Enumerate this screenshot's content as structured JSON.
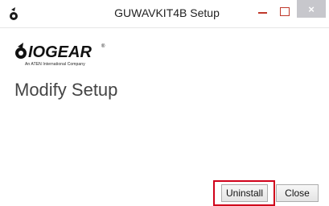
{
  "window": {
    "title": "GUWAVKIT4B Setup",
    "icon": "iogear-app-icon",
    "controls": {
      "minimize_icon": "minimize-icon",
      "maximize_icon": "maximize-icon",
      "close_glyph": "×"
    }
  },
  "branding": {
    "logo_text": "IOGEAR",
    "logo_trademark": "®",
    "tagline": "An ATEN International Company"
  },
  "main": {
    "heading": "Modify Setup"
  },
  "buttons": {
    "uninstall_label": "Uninstall",
    "close_label": "Close"
  },
  "colors": {
    "highlight": "#d0021b",
    "window_controls": "#c0392b",
    "close_button_bg": "#c7c7cc"
  }
}
